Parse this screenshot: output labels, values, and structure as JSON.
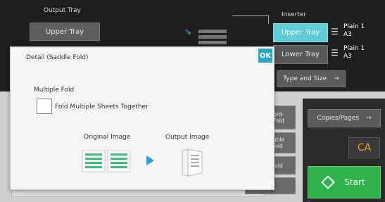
{
  "output_tray": {
    "title": "Output Tray",
    "upper_tray": "Upper Tray"
  },
  "inserter": {
    "title": "Inserter",
    "upper_tray": "Upper Tray",
    "lower_tray": "Lower Tray",
    "upper_paper_type": "Plain 1",
    "upper_paper_size": "A3",
    "lower_paper_type": "Plain 1",
    "lower_paper_size": "A3",
    "type_and_size": "Type and Size",
    "type_and_size_arrow": "→"
  },
  "dialog": {
    "title": "Detail (Saddle Fold)",
    "ok": "OK",
    "multiple_fold_label": "Multiple Fold",
    "checkbox_label": "Fold Multiple Sheets Together",
    "checkbox_checked": false,
    "original_image_label": "Original Image",
    "output_image_label": "Output Image"
  },
  "side_buttons": {
    "fold_a": "ord-\nFold",
    "fold_b": "uble\nold",
    "fold_c": "old",
    "fold_d": "l"
  },
  "right_panel": {
    "copies_pages": "Copies/Pages",
    "copies_arrow": "→",
    "ca": "CA",
    "start": "Start"
  },
  "colors": {
    "accent": "#5fcbd6",
    "start_green": "#2fb24a",
    "ca_orange": "#f0a020",
    "ok_teal": "#2aa6c0"
  }
}
